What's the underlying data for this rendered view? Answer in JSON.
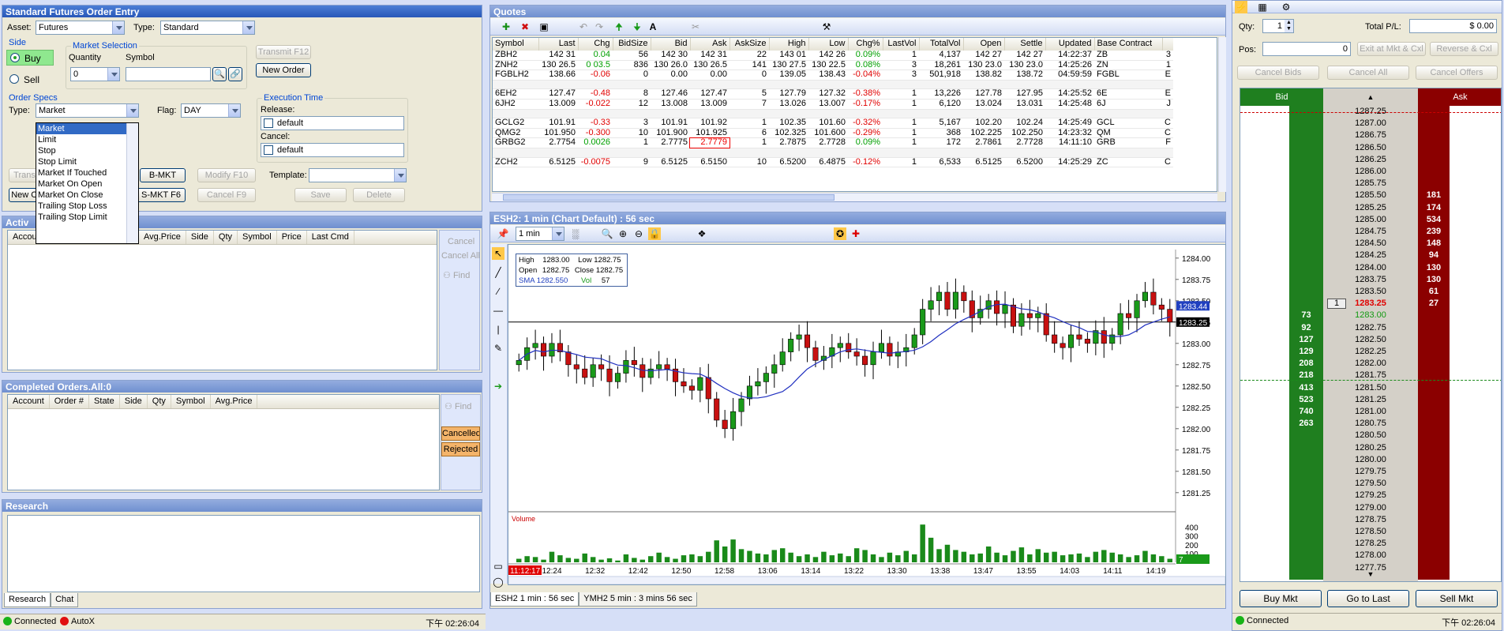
{
  "order_entry": {
    "title": "Standard Futures Order Entry",
    "asset_label": "Asset:",
    "asset_value": "Futures",
    "type_label": "Type:",
    "type_value": "Standard",
    "side_label": "Side",
    "buy": "Buy",
    "sell": "Sell",
    "market_selection": "Market Selection",
    "quantity_label": "Quantity",
    "quantity_value": "0",
    "symbol_label": "Symbol",
    "transmit": "Transmit F12",
    "new_order": "New Order",
    "order_specs": "Order Specs",
    "os_type_label": "Type:",
    "os_type_value": "Market",
    "flag_label": "Flag:",
    "flag_value": "DAY",
    "exec_time": "Execution Time",
    "release_label": "Release:",
    "release_value": "default",
    "cancel_label": "Cancel:",
    "cancel_value": "default",
    "dropdown_options": [
      "Market",
      "Limit",
      "Stop",
      "Stop Limit",
      "Market If Touched",
      "Market On Open",
      "Market On Close",
      "Trailing Stop Loss",
      "Trailing Stop Limit"
    ],
    "btn_trans": "Trans",
    "btn_bmkt": "B-MKT",
    "btn_modify": "Modify F10",
    "btn_template": "Template:",
    "btn_new_o": "New O",
    "btn_smkt": "S-MKT F6",
    "btn_cancel_f9": "Cancel F9",
    "btn_save": "Save",
    "btn_delete": "Delete"
  },
  "active_orders": {
    "title": "Activ",
    "columns": [
      "Accoun",
      "Avg.Price",
      "Side",
      "Qty",
      "Symbol",
      "Price",
      "Last Cmd"
    ],
    "cancel": "Cancel",
    "cancel_all": "Cancel All",
    "find": "Find"
  },
  "completed_orders": {
    "title": "Completed Orders.All:0",
    "columns": [
      "Account",
      "Order #",
      "State",
      "Side",
      "Qty",
      "Symbol",
      "Avg.Price"
    ],
    "find": "Find",
    "cancelled": "Cancelled",
    "rejected": "Rejected"
  },
  "research": {
    "title": "Research",
    "tabs": [
      "Research",
      "Chat"
    ]
  },
  "status_left": {
    "connected": "Connected",
    "autox": "AutoX",
    "time": "下午 02:26:04"
  },
  "quotes": {
    "title": "Quotes",
    "columns": [
      "Symbol",
      "Last",
      "Chg",
      "BidSize",
      "Bid",
      "Ask",
      "AskSize",
      "High",
      "Low",
      "Chg%",
      "LastVol",
      "TotalVol",
      "Open",
      "Settle",
      "Updated",
      "Base Contract"
    ],
    "rows": [
      [
        "ZBH2",
        "142 31",
        "0.04",
        "56",
        "142 30",
        "142 31",
        "22",
        "143 01",
        "142 26",
        "0.09%",
        "1",
        "4,137",
        "142 27",
        "142 27",
        "14:22:37",
        "ZB",
        "3"
      ],
      [
        "ZNH2",
        "130 26.5",
        "0 03.5",
        "836",
        "130 26.0",
        "130 26.5",
        "141",
        "130 27.5",
        "130 22.5",
        "0.08%",
        "3",
        "18,261",
        "130 23.0",
        "130 23.0",
        "14:25:26",
        "ZN",
        "1"
      ],
      [
        "FGBLH2",
        "138.66",
        "-0.06",
        "0",
        "0.00",
        "0.00",
        "0",
        "139.05",
        "138.43",
        "-0.04%",
        "3",
        "501,918",
        "138.82",
        "138.72",
        "04:59:59",
        "FGBL",
        "E"
      ],
      [
        "",
        "",
        "",
        "",
        "",
        "",
        "",
        "",
        "",
        "",
        "",
        "",
        "",
        "",
        "",
        "",
        ""
      ],
      [
        "6EH2",
        "127.47",
        "-0.48",
        "8",
        "127.46",
        "127.47",
        "5",
        "127.79",
        "127.32",
        "-0.38%",
        "1",
        "13,226",
        "127.78",
        "127.95",
        "14:25:52",
        "6E",
        "E"
      ],
      [
        "6JH2",
        "13.009",
        "-0.022",
        "12",
        "13.008",
        "13.009",
        "7",
        "13.026",
        "13.007",
        "-0.17%",
        "1",
        "6,120",
        "13.024",
        "13.031",
        "14:25:48",
        "6J",
        "J"
      ],
      [
        "",
        "",
        "",
        "",
        "",
        "",
        "",
        "",
        "",
        "",
        "",
        "",
        "",
        "",
        "",
        "",
        ""
      ],
      [
        "GCLG2",
        "101.91",
        "-0.33",
        "3",
        "101.91",
        "101.92",
        "1",
        "102.35",
        "101.60",
        "-0.32%",
        "1",
        "5,167",
        "102.20",
        "102.24",
        "14:25:49",
        "GCL",
        "C"
      ],
      [
        "QMG2",
        "101.950",
        "-0.300",
        "10",
        "101.900",
        "101.925",
        "6",
        "102.325",
        "101.600",
        "-0.29%",
        "1",
        "368",
        "102.225",
        "102.250",
        "14:23:32",
        "QM",
        "C"
      ],
      [
        "GRBG2",
        "2.7754",
        "0.0026",
        "1",
        "2.7775",
        "2.7779",
        "1",
        "2.7875",
        "2.7728",
        "0.09%",
        "1",
        "172",
        "2.7861",
        "2.7728",
        "14:11:10",
        "GRB",
        "F"
      ],
      [
        "",
        "",
        "",
        "",
        "",
        "",
        "",
        "",
        "",
        "",
        "",
        "",
        "",
        "",
        "",
        "",
        ""
      ],
      [
        "ZCH2",
        "6.5125",
        "-0.0075",
        "9",
        "6.5125",
        "6.5150",
        "10",
        "6.5200",
        "6.4875",
        "-0.12%",
        "1",
        "6,533",
        "6.5125",
        "6.5200",
        "14:25:29",
        "ZC",
        "C"
      ]
    ]
  },
  "chart": {
    "title": "ESH2: 1 min (Chart Default) : 56 sec",
    "interval": "1 min",
    "info": {
      "high_l": "High",
      "high": "1283.00",
      "low_l": "Low",
      "low": "1282.75",
      "open_l": "Open",
      "open": "1282.75",
      "close_l": "Close",
      "close": "1282.75",
      "sma_l": "SMA",
      "sma": "1282.550",
      "vol_l": "Vol",
      "vol": "57"
    },
    "volume_label": "Volume",
    "start_time": "11:12:17",
    "tabs": [
      "ESH2 1 min : 56 sec",
      "YMH2 5 min : 3 mins 56 sec"
    ]
  },
  "chart_data": {
    "type": "candlestick",
    "y_ticks": [
      "1284.00",
      "1283.75",
      "1283.50",
      "1283.25",
      "1283.00",
      "1282.75",
      "1282.50",
      "1282.25",
      "1282.00",
      "1281.75",
      "1281.50",
      "1281.25"
    ],
    "ylim": [
      1281.1,
      1284.1
    ],
    "x_ticks": [
      "12:24",
      "12:32",
      "12:42",
      "12:50",
      "12:58",
      "13:06",
      "13:14",
      "13:22",
      "13:30",
      "13:38",
      "13:47",
      "13:55",
      "14:03",
      "14:11",
      "14:19"
    ],
    "price_flags": [
      "1283.44",
      "1283.25"
    ],
    "volume_ticks": [
      "400",
      "300",
      "200",
      "100"
    ],
    "volume_last": "7",
    "closes": [
      1282.8,
      1282.95,
      1283.0,
      1282.85,
      1283.0,
      1282.9,
      1282.75,
      1282.7,
      1282.6,
      1282.75,
      1282.7,
      1282.55,
      1282.65,
      1282.8,
      1282.75,
      1282.6,
      1282.7,
      1282.75,
      1282.7,
      1282.55,
      1282.5,
      1282.45,
      1282.6,
      1282.35,
      1282.1,
      1282.0,
      1282.2,
      1282.35,
      1282.5,
      1282.55,
      1282.65,
      1282.75,
      1282.9,
      1283.05,
      1283.1,
      1282.95,
      1282.8,
      1282.85,
      1282.95,
      1283.0,
      1282.9,
      1282.85,
      1282.75,
      1282.9,
      1283.0,
      1282.85,
      1282.9,
      1282.95,
      1283.1,
      1283.4,
      1283.5,
      1283.6,
      1283.4,
      1283.6,
      1283.5,
      1283.3,
      1283.4,
      1283.5,
      1283.35,
      1283.45,
      1283.2,
      1283.35,
      1283.3,
      1283.35,
      1283.1,
      1283.0,
      1282.95,
      1283.1,
      1283.05,
      1283.0,
      1283.15,
      1283.0,
      1283.1,
      1283.35,
      1283.3,
      1283.5,
      1283.6,
      1283.45,
      1283.4,
      1283.25
    ],
    "volumes": [
      40,
      70,
      60,
      30,
      120,
      80,
      50,
      40,
      100,
      60,
      30,
      45,
      20,
      90,
      50,
      30,
      70,
      110,
      60,
      40,
      80,
      90,
      70,
      120,
      250,
      180,
      260,
      150,
      130,
      100,
      90,
      140,
      160,
      110,
      70,
      90,
      60,
      120,
      80,
      100,
      70,
      160,
      140,
      90,
      60,
      110,
      80,
      130,
      90,
      430,
      280,
      150,
      200,
      140,
      120,
      90,
      100,
      180,
      110,
      80,
      130,
      170,
      90,
      150,
      110,
      120,
      80,
      90,
      100,
      60,
      120,
      140,
      110,
      90,
      60,
      80,
      130,
      90,
      70,
      40
    ]
  },
  "dom": {
    "qty_label": "Qty:",
    "qty_value": "1",
    "total_pl_label": "Total P/L:",
    "total_pl_value": "$ 0.00",
    "pos_label": "Pos:",
    "pos_value": "0",
    "exit": "Exit at Mkt & Cxl",
    "reverse": "Reverse & Cxl",
    "cancel_bids": "Cancel Bids",
    "cancel_all": "Cancel All",
    "cancel_offers": "Cancel Offers",
    "bid_header": "Bid",
    "ask_header": "Ask",
    "rows": [
      {
        "price": "1287.25",
        "bid": "",
        "ask": ""
      },
      {
        "price": "1287.00",
        "bid": "",
        "ask": ""
      },
      {
        "price": "1286.75",
        "bid": "",
        "ask": ""
      },
      {
        "price": "1286.50",
        "bid": "",
        "ask": ""
      },
      {
        "price": "1286.25",
        "bid": "",
        "ask": ""
      },
      {
        "price": "1286.00",
        "bid": "",
        "ask": ""
      },
      {
        "price": "1285.75",
        "bid": "",
        "ask": ""
      },
      {
        "price": "1285.50",
        "bid": "",
        "ask": "181"
      },
      {
        "price": "1285.25",
        "bid": "",
        "ask": "174"
      },
      {
        "price": "1285.00",
        "bid": "",
        "ask": "534"
      },
      {
        "price": "1284.75",
        "bid": "",
        "ask": "239"
      },
      {
        "price": "1284.50",
        "bid": "",
        "ask": "148"
      },
      {
        "price": "1284.25",
        "bid": "",
        "ask": "94"
      },
      {
        "price": "1284.00",
        "bid": "",
        "ask": "130"
      },
      {
        "price": "1283.75",
        "bid": "",
        "ask": "130"
      },
      {
        "price": "1283.50",
        "bid": "",
        "ask": "61"
      },
      {
        "price": "1283.25",
        "bid": "",
        "ask": "27",
        "mid": "1",
        "last": true
      },
      {
        "price": "1283.00",
        "bid": "73",
        "ask": "",
        "green": true
      },
      {
        "price": "1282.75",
        "bid": "92",
        "ask": ""
      },
      {
        "price": "1282.50",
        "bid": "127",
        "ask": ""
      },
      {
        "price": "1282.25",
        "bid": "129",
        "ask": ""
      },
      {
        "price": "1282.00",
        "bid": "208",
        "ask": ""
      },
      {
        "price": "1281.75",
        "bid": "218",
        "ask": ""
      },
      {
        "price": "1281.50",
        "bid": "413",
        "ask": ""
      },
      {
        "price": "1281.25",
        "bid": "523",
        "ask": ""
      },
      {
        "price": "1281.00",
        "bid": "740",
        "ask": ""
      },
      {
        "price": "1280.75",
        "bid": "263",
        "ask": ""
      },
      {
        "price": "1280.50",
        "bid": "",
        "ask": ""
      },
      {
        "price": "1280.25",
        "bid": "",
        "ask": ""
      },
      {
        "price": "1280.00",
        "bid": "",
        "ask": ""
      },
      {
        "price": "1279.75",
        "bid": "",
        "ask": ""
      },
      {
        "price": "1279.50",
        "bid": "",
        "ask": ""
      },
      {
        "price": "1279.25",
        "bid": "",
        "ask": ""
      },
      {
        "price": "1279.00",
        "bid": "",
        "ask": ""
      },
      {
        "price": "1278.75",
        "bid": "",
        "ask": ""
      },
      {
        "price": "1278.50",
        "bid": "",
        "ask": ""
      },
      {
        "price": "1278.25",
        "bid": "",
        "ask": ""
      },
      {
        "price": "1278.00",
        "bid": "",
        "ask": ""
      },
      {
        "price": "1277.75",
        "bid": "",
        "ask": ""
      }
    ],
    "buy_mkt": "Buy Mkt",
    "go_to_last": "Go to Last",
    "sell_mkt": "Sell Mkt",
    "connected": "Connected",
    "time": "下午 02:26:04"
  },
  "colors": {
    "title_blue": "#2857b8",
    "bid_green": "#1f7f1f",
    "ask_red": "#8b0000",
    "candle_up": "#1a9a1a",
    "candle_down": "#c81010"
  }
}
